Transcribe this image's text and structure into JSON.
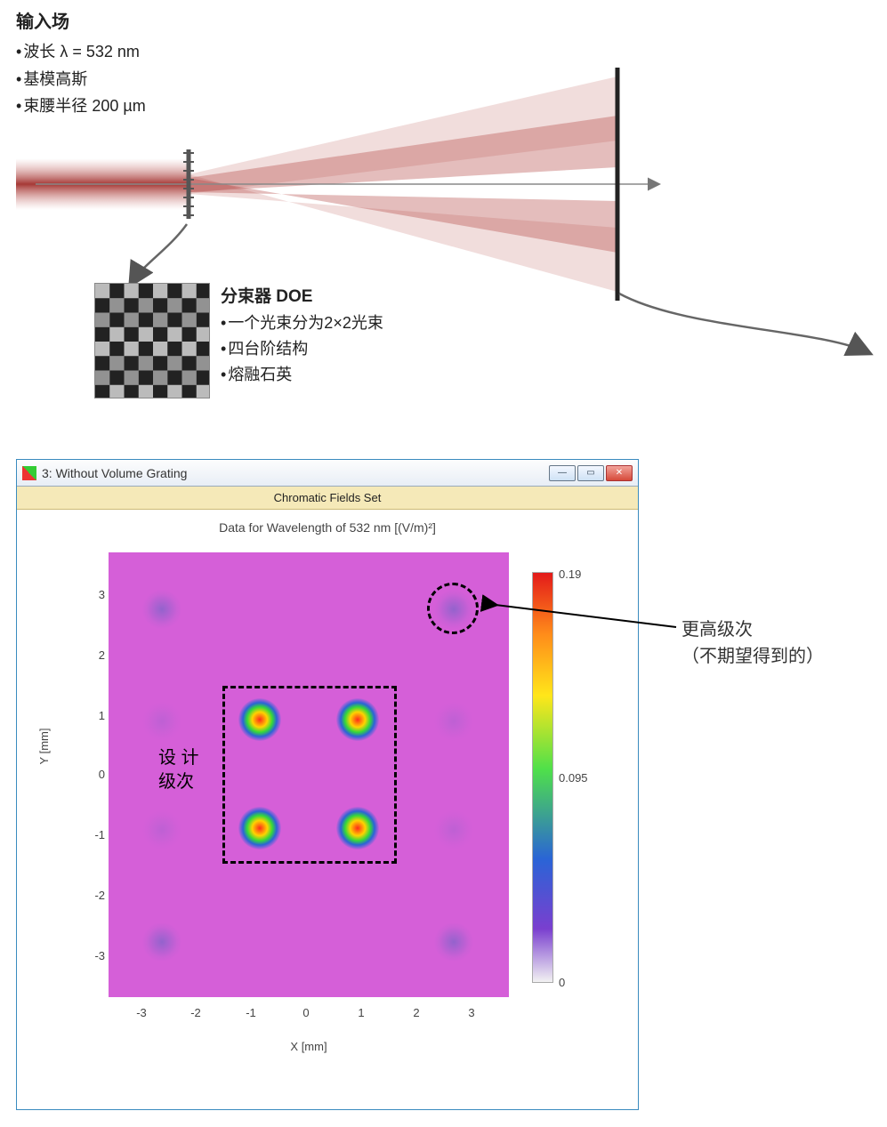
{
  "input_field": {
    "heading": "输入场",
    "items": [
      "波长 λ = 532 nm",
      "基模高斯",
      "束腰半径 200 µm"
    ]
  },
  "doe": {
    "heading": "分束器 DOE",
    "items": [
      "一个光束分为2×2光束",
      "四台阶结构",
      "熔融石英"
    ]
  },
  "window": {
    "title": "3: Without Volume Grating",
    "subheader": "Chromatic Fields Set",
    "chart_title": "Data for Wavelength of 532 nm  [(V/m)²]",
    "x_axis": "X [mm]",
    "y_axis": "Y [mm]"
  },
  "plot_labels": {
    "design_orders_l1": "设 计",
    "design_orders_l2": "级次",
    "higher_orders_l1": "更高级次",
    "higher_orders_l2": "（不期望得到的）"
  },
  "chart_data": {
    "type": "heatmap",
    "title": "Data for Wavelength of 532 nm  [(V/m)²]",
    "xlabel": "X [mm]",
    "ylabel": "Y [mm]",
    "x_ticks": [
      -3,
      -2,
      -1,
      0,
      1,
      2,
      3
    ],
    "y_ticks": [
      -3,
      -2,
      -1,
      0,
      1,
      2,
      3
    ],
    "xlim": [
      -3.7,
      3.7
    ],
    "ylim": [
      -3.7,
      3.7
    ],
    "colorbar": {
      "min": 0,
      "mid": 0.095,
      "max": 0.19,
      "unit": "(V/m)²"
    },
    "design_orders": [
      {
        "x": -0.9,
        "y": 0.9,
        "intensity": 0.19
      },
      {
        "x": 0.9,
        "y": 0.9,
        "intensity": 0.19
      },
      {
        "x": -0.9,
        "y": -0.9,
        "intensity": 0.19
      },
      {
        "x": 0.9,
        "y": -0.9,
        "intensity": 0.19
      }
    ],
    "higher_orders": [
      {
        "x": -2.7,
        "y": 2.7,
        "intensity": 0.03
      },
      {
        "x": 2.7,
        "y": 2.7,
        "intensity": 0.03
      },
      {
        "x": -2.7,
        "y": -2.7,
        "intensity": 0.03
      },
      {
        "x": 2.7,
        "y": -2.7,
        "intensity": 0.03
      },
      {
        "x": -2.7,
        "y": 0.9,
        "intensity": 0.01
      },
      {
        "x": 2.7,
        "y": 0.9,
        "intensity": 0.01
      },
      {
        "x": -2.7,
        "y": -0.9,
        "intensity": 0.01
      },
      {
        "x": 2.7,
        "y": -0.9,
        "intensity": 0.01
      }
    ],
    "annotations": [
      {
        "text": "设计级次",
        "region": {
          "xmin": -1.3,
          "xmax": 1.3,
          "ymin": -1.3,
          "ymax": 1.3
        }
      },
      {
        "text": "更高级次（不期望得到的）",
        "point": {
          "x": 2.7,
          "y": 2.7
        }
      }
    ]
  },
  "colorbar_ticks": {
    "max": "0.19",
    "mid": "0.095",
    "min": "0"
  }
}
